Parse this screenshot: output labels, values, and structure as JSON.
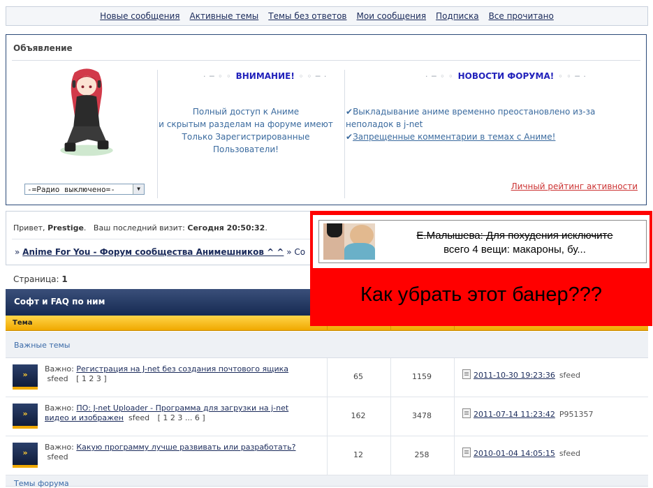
{
  "navbar": {
    "items": [
      "Новые сообщения",
      "Активные темы",
      "Темы без ответов",
      "Мои сообщения",
      "Подписка",
      "Все прочитано"
    ]
  },
  "announcement": {
    "title": "Объявление",
    "radio_select": "-=Радио выключено=-",
    "warning_heading": "ВНИМАНИЕ!",
    "warning_text_lines": [
      "Полный доступ к Аниме",
      "и скрытым разделам на форуме имеют",
      "Только Зарегистрированные",
      "Пользователи!"
    ],
    "news_heading": "НОВОСТИ ФОРУМА!",
    "news_items": [
      "Выкладывание аниме временно преостановлено из-за",
      "неполадок в j-net",
      "Запрещенные комментарии в темах с Аниме!"
    ],
    "rating_link": "Личный рейтинг активности"
  },
  "greeting": {
    "hello": "Привет,",
    "user": "Prestige",
    "last_visit_label": "Ваш последний визит:",
    "last_visit_value": "Сегодня 20:50:32",
    "breadcrumb_prefix": "»",
    "breadcrumb_link": "Anime For You - Форум сообщества Анимешников ^ ^",
    "breadcrumb_sep": "» Со"
  },
  "page_info": {
    "label": "Страница:",
    "value": "1"
  },
  "forum": {
    "title": "Софт и FAQ по ним",
    "column_topic": "Тема",
    "section_important": "Важные темы",
    "section_forum_topics": "Темы форума",
    "topics": [
      {
        "prefix": "Важно:",
        "title": "Регистрация на J-net без создания почтового ящика",
        "author": "sfeed",
        "pages": "[ 1 2 3 ]",
        "replies": "65",
        "views": "1159",
        "last_date": "2011-10-30 19:23:36",
        "last_user": "sfeed"
      },
      {
        "prefix": "Важно:",
        "title": "ПО: J-net Uploader - Программа для загрузки на j-net видео и изображен",
        "author": "sfeed",
        "pages": "[ 1 2 3 ... 6 ]",
        "replies": "162",
        "views": "3478",
        "last_date": "2011-07-14 11:23:42",
        "last_user": "P951357"
      },
      {
        "prefix": "Важно:",
        "title": "Какую программу лучше развивать или разработать?",
        "author": "sfeed",
        "pages": "",
        "replies": "12",
        "views": "258",
        "last_date": "2010-01-04 14:05:15",
        "last_user": "sfeed"
      }
    ]
  },
  "banner": {
    "ad_line1": "Е.Малышева: Для похудения исключите",
    "ad_line2": "всего 4 вещи: макароны, бу...",
    "question": "Как убрать этот банер???"
  },
  "colors": {
    "navy": "#162a52",
    "gold": "#f0a900",
    "banner_red": "#ff0000",
    "heading_blue": "#2222bb"
  }
}
